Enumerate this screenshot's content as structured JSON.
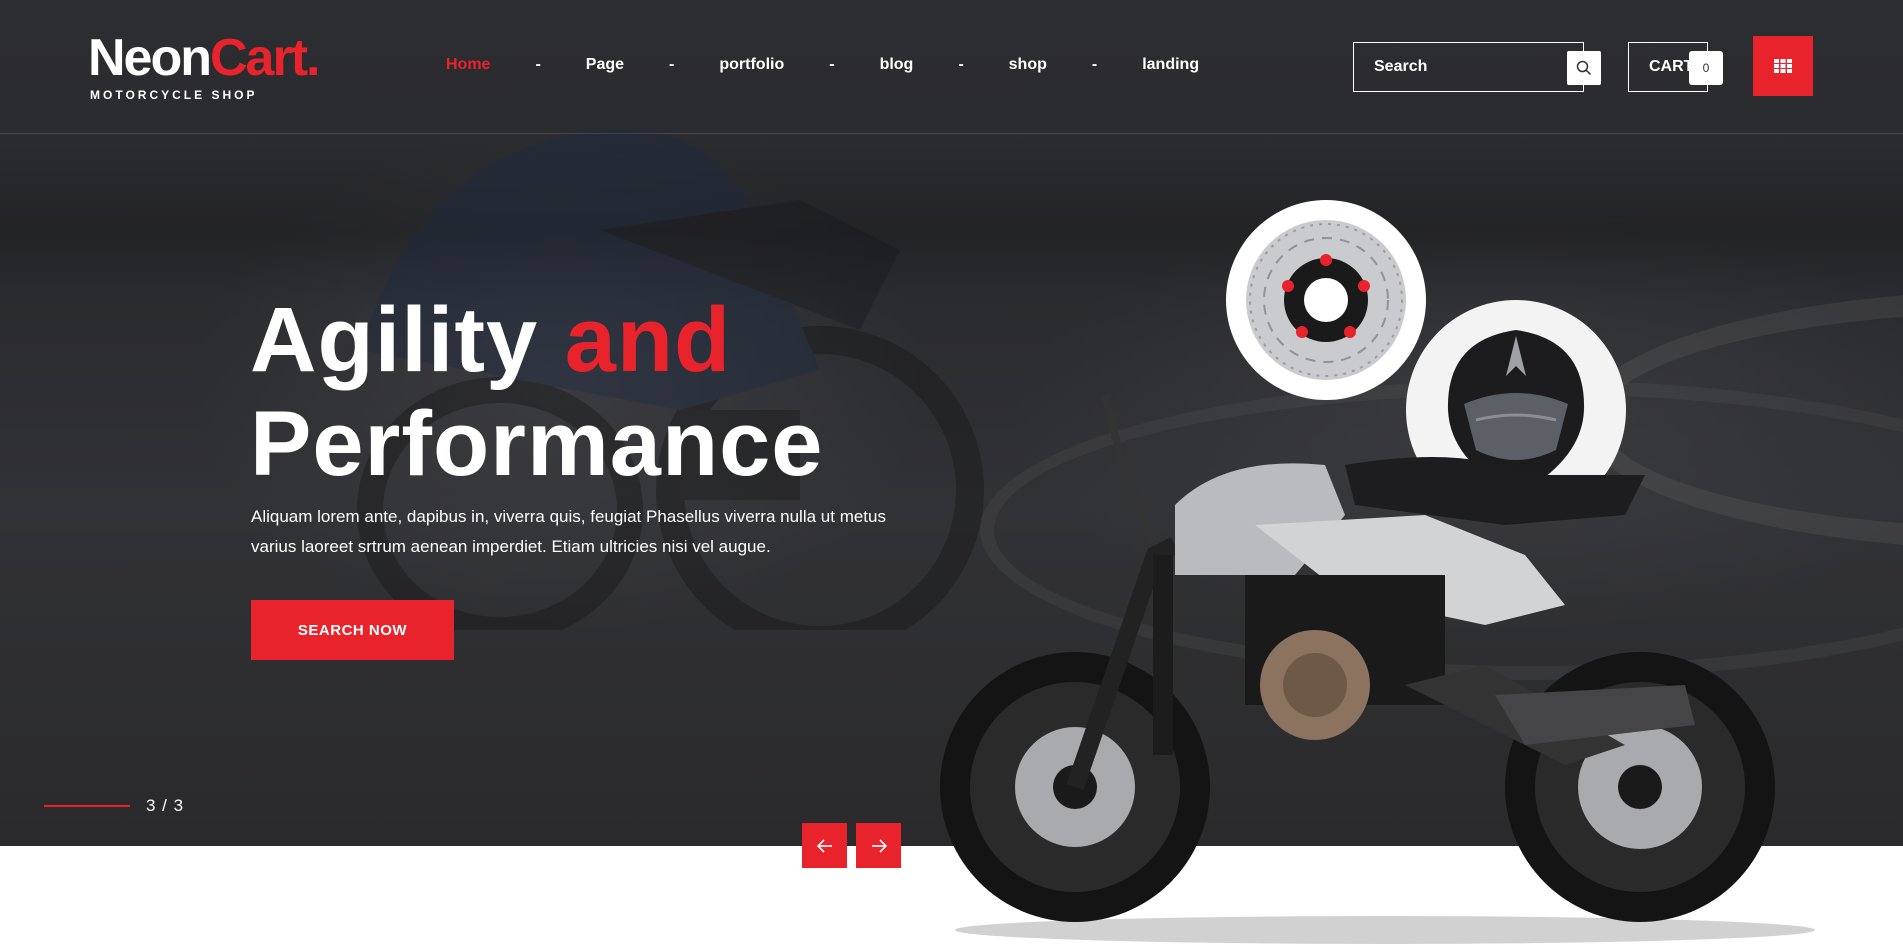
{
  "brand": {
    "name_part1": "Neon",
    "name_part2": "Cart.",
    "tagline": "MOTORCYCLE SHOP"
  },
  "nav": {
    "items": [
      {
        "label": "Home",
        "active": true
      },
      {
        "label": "Page",
        "active": false
      },
      {
        "label": "portfolio",
        "active": false
      },
      {
        "label": "blog",
        "active": false
      },
      {
        "label": "shop",
        "active": false
      },
      {
        "label": "landing",
        "active": false
      }
    ],
    "separator": "-"
  },
  "search": {
    "placeholder": "Search",
    "icon": "search-icon"
  },
  "cart": {
    "label": "CART",
    "count": "0"
  },
  "menu_button": {
    "icon": "grid-icon"
  },
  "hero": {
    "headline_word1": "Agility",
    "headline_word2": "and",
    "headline_line2": "Performance",
    "description": "Aliquam lorem ante, dapibus in, viverra quis, feugiat Phasellus viverra nulla ut metus varius laoreet srtrum aenean imperdiet. Etiam ultricies nisi vel augue.",
    "cta_label": "SEARCH NOW",
    "slide_counter": "3 / 3"
  },
  "slider_controls": {
    "prev_icon": "arrow-left-icon",
    "next_icon": "arrow-right-icon"
  },
  "colors": {
    "accent": "#e8232b",
    "hero_bg": "#2c2d30",
    "text_light": "#ffffff"
  }
}
